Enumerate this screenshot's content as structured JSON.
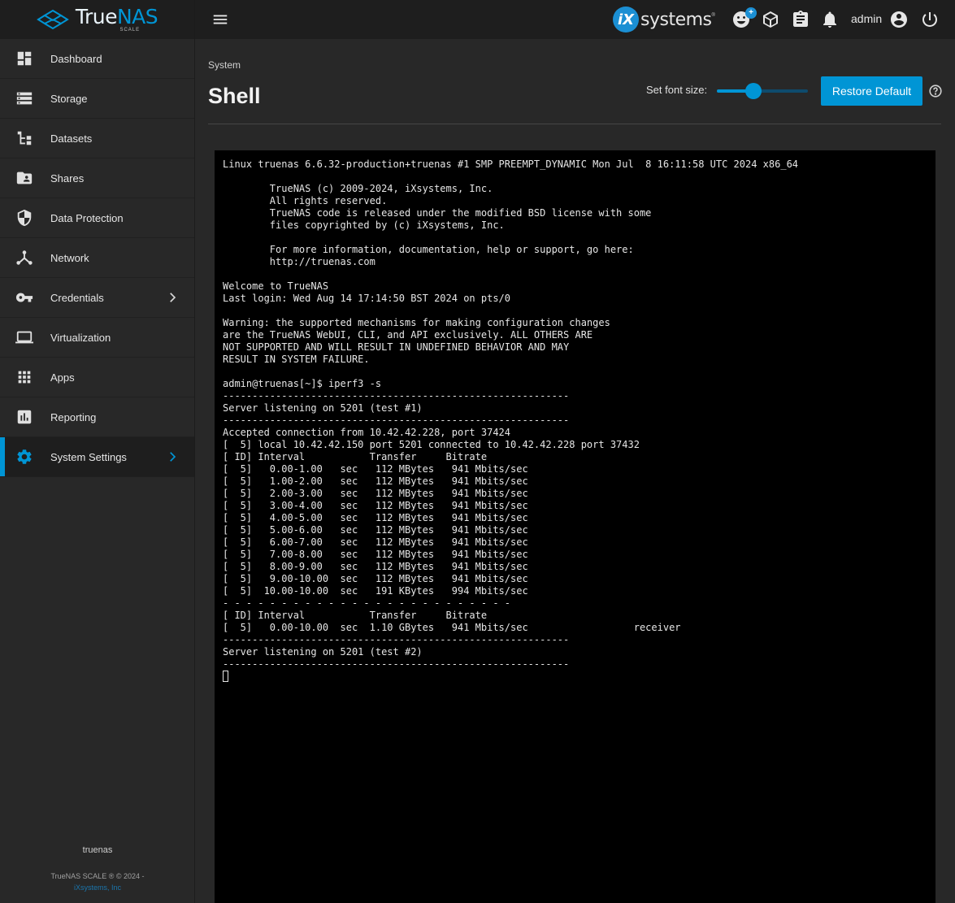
{
  "brand": {
    "name_main": "True",
    "name_accent": "NAS",
    "edition": "SCALE"
  },
  "topbar": {
    "vendor": "systems",
    "vendor_mark": "iX",
    "vendor_reg": "®",
    "update_badge": "+",
    "username": "admin"
  },
  "sidebar": {
    "items": [
      {
        "label": "Dashboard",
        "icon": "dashboard-icon"
      },
      {
        "label": "Storage",
        "icon": "storage-icon"
      },
      {
        "label": "Datasets",
        "icon": "datasets-icon"
      },
      {
        "label": "Shares",
        "icon": "shares-icon"
      },
      {
        "label": "Data Protection",
        "icon": "security-icon"
      },
      {
        "label": "Network",
        "icon": "network-icon"
      },
      {
        "label": "Credentials",
        "icon": "key-icon",
        "has_children": true
      },
      {
        "label": "Virtualization",
        "icon": "laptop-icon"
      },
      {
        "label": "Apps",
        "icon": "apps-icon"
      },
      {
        "label": "Reporting",
        "icon": "chart-icon"
      },
      {
        "label": "System Settings",
        "icon": "gear-icon",
        "has_children": true,
        "active": true
      }
    ],
    "hostname": "truenas",
    "copyright": "TrueNAS SCALE ® © 2024 -",
    "company": "iXsystems, Inc"
  },
  "page": {
    "breadcrumb": "System",
    "title": "Shell",
    "font_size_label": "Set font size:",
    "font_size_slider": 0.4,
    "restore_label": "Restore Default"
  },
  "accent_color": "#0095d5",
  "terminal": {
    "lines": [
      "Linux truenas 6.6.32-production+truenas #1 SMP PREEMPT_DYNAMIC Mon Jul  8 16:11:58 UTC 2024 x86_64",
      "",
      "        TrueNAS (c) 2009-2024, iXsystems, Inc.",
      "        All rights reserved.",
      "        TrueNAS code is released under the modified BSD license with some",
      "        files copyrighted by (c) iXsystems, Inc.",
      "",
      "        For more information, documentation, help or support, go here:",
      "        http://truenas.com",
      "",
      "Welcome to TrueNAS",
      "Last login: Wed Aug 14 17:14:50 BST 2024 on pts/0",
      "",
      "Warning: the supported mechanisms for making configuration changes",
      "are the TrueNAS WebUI, CLI, and API exclusively. ALL OTHERS ARE",
      "NOT SUPPORTED AND WILL RESULT IN UNDEFINED BEHAVIOR AND MAY",
      "RESULT IN SYSTEM FAILURE.",
      "",
      "admin@truenas[~]$ iperf3 -s",
      "-----------------------------------------------------------",
      "Server listening on 5201 (test #1)",
      "-----------------------------------------------------------",
      "Accepted connection from 10.42.42.228, port 37424",
      "[  5] local 10.42.42.150 port 5201 connected to 10.42.42.228 port 37432",
      "[ ID] Interval           Transfer     Bitrate",
      "[  5]   0.00-1.00   sec   112 MBytes   941 Mbits/sec",
      "[  5]   1.00-2.00   sec   112 MBytes   941 Mbits/sec",
      "[  5]   2.00-3.00   sec   112 MBytes   941 Mbits/sec",
      "[  5]   3.00-4.00   sec   112 MBytes   941 Mbits/sec",
      "[  5]   4.00-5.00   sec   112 MBytes   941 Mbits/sec",
      "[  5]   5.00-6.00   sec   112 MBytes   941 Mbits/sec",
      "[  5]   6.00-7.00   sec   112 MBytes   941 Mbits/sec",
      "[  5]   7.00-8.00   sec   112 MBytes   941 Mbits/sec",
      "[  5]   8.00-9.00   sec   112 MBytes   941 Mbits/sec",
      "[  5]   9.00-10.00  sec   112 MBytes   941 Mbits/sec",
      "[  5]  10.00-10.00  sec   191 KBytes   994 Mbits/sec",
      "- - - - - - - - - - - - - - - - - - - - - - - - -",
      "[ ID] Interval           Transfer     Bitrate",
      "[  5]   0.00-10.00  sec  1.10 GBytes   941 Mbits/sec                  receiver",
      "-----------------------------------------------------------",
      "Server listening on 5201 (test #2)",
      "-----------------------------------------------------------"
    ]
  }
}
